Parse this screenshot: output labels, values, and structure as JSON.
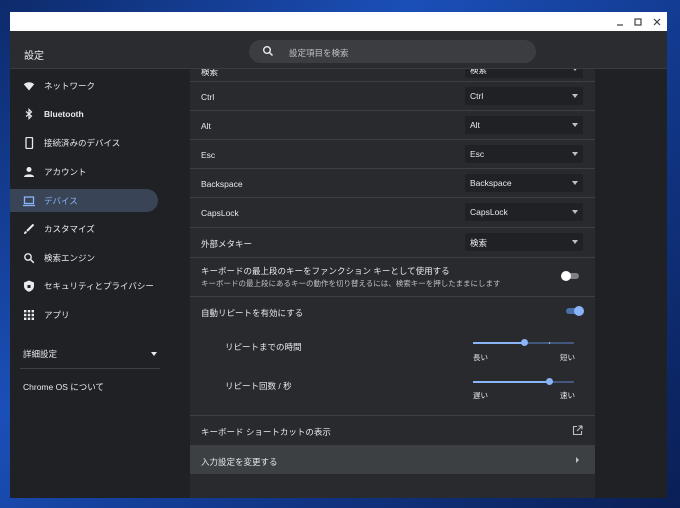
{
  "app": {
    "title": "設定",
    "search_placeholder": "設定項目を検索"
  },
  "window_controls": {
    "minimize_icon": "minimize-icon",
    "maximize_icon": "maximize-icon",
    "close_icon": "close-icon"
  },
  "sidebar": {
    "items": [
      {
        "label": "ネットワーク",
        "icon": "wifi-icon"
      },
      {
        "label": "Bluetooth",
        "icon": "bluetooth-icon"
      },
      {
        "label": "接続済みのデバイス",
        "icon": "phone-icon"
      },
      {
        "label": "アカウント",
        "icon": "person-icon"
      },
      {
        "label": "デバイス",
        "icon": "laptop-icon",
        "active": true
      },
      {
        "label": "カスタマイズ",
        "icon": "brush-icon"
      },
      {
        "label": "検索エンジン",
        "icon": "search-icon"
      },
      {
        "label": "セキュリティとプライバシー",
        "icon": "shield-icon"
      },
      {
        "label": "アプリ",
        "icon": "apps-grid-icon"
      }
    ],
    "advanced_label": "詳細設定",
    "about_label": "Chrome OS について"
  },
  "keyboard": {
    "remap_rows": [
      {
        "label": "検索",
        "value": "検索"
      },
      {
        "label": "Ctrl",
        "value": "Ctrl"
      },
      {
        "label": "Alt",
        "value": "Alt"
      },
      {
        "label": "Esc",
        "value": "Esc"
      },
      {
        "label": "Backspace",
        "value": "Backspace"
      },
      {
        "label": "CapsLock",
        "value": "CapsLock"
      },
      {
        "label": "外部メタキー",
        "value": "検索"
      }
    ],
    "top_row_fn": {
      "label": "キーボードの最上段のキーをファンクション キーとして使用する",
      "sublabel": "キーボードの最上段にあるキーの動作を切り替えるには、検索キーを押したままにします",
      "enabled": false
    },
    "auto_repeat": {
      "label": "自動リピートを有効にする",
      "enabled": true
    },
    "repeat_delay": {
      "label": "リピートまでの時間",
      "low_label": "長い",
      "high_label": "短い",
      "value": 0.5
    },
    "repeat_rate": {
      "label": "リピート回数 / 秒",
      "low_label": "遅い",
      "high_label": "速い",
      "value": 0.75
    },
    "shortcuts_label": "キーボード ショートカットの表示",
    "input_settings_label": "入力設定を変更する"
  },
  "colors": {
    "accent": "#8ab4f8",
    "active_nav_bg": "#394457",
    "content_bg": "#292a2d"
  }
}
